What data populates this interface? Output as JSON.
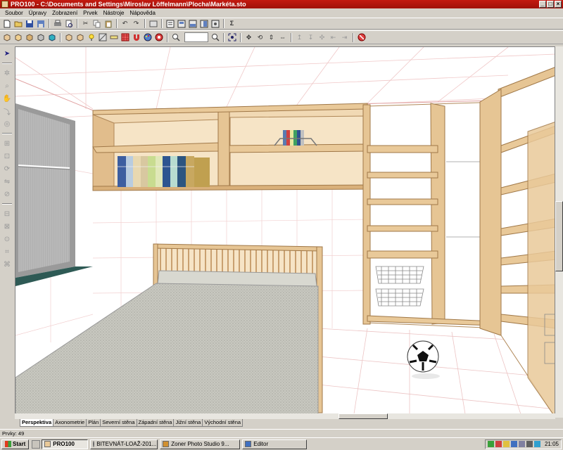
{
  "window": {
    "title": "PRO100 - C:\\Documents and Settings\\Miroslav Löffelmann\\Plocha\\Markéta.sto"
  },
  "menu": [
    "Soubor",
    "Úpravy",
    "Zobrazení",
    "Prvek",
    "Nástroje",
    "Nápověda"
  ],
  "toolbar1": [
    "new-icon",
    "open-icon",
    "save-icon",
    "save-as-icon",
    "print-icon",
    "print-preview-icon",
    "cut-icon",
    "copy-icon",
    "paste-icon",
    "undo-icon",
    "redo-icon",
    "export-icon",
    "catalog-icon",
    "report-icon",
    "list-icon",
    "materials-icon",
    "settings-icon",
    "sum-icon"
  ],
  "toolbar2": [
    "box-icon",
    "cube-icon",
    "cube2-icon",
    "cube3-icon",
    "cube4-icon",
    "cube5-icon",
    "cube6-icon",
    "light-icon",
    "texture-icon",
    "measure-icon",
    "grid-icon",
    "magnet-icon",
    "palette-icon",
    "render-icon",
    "zoom-out-icon",
    "zoom-in-icon",
    "select-all-icon",
    "move-icon",
    "rotate-icon",
    "align-icon",
    "stop-icon"
  ],
  "view_tabs": [
    "Perspektiva",
    "Axonometrie",
    "Plán",
    "Severní stěna",
    "Západní stěna",
    "Jižní stěna",
    "Východní stěna"
  ],
  "active_tab": "Perspektiva",
  "status": {
    "text": "Prvky: 49"
  },
  "taskbar": {
    "start_label": "Start",
    "pinned_app": "PRO100",
    "tasks": [
      "BITEVNÁT-LOAŽ-201...",
      "Zoner Photo Studio 9...",
      "Editor"
    ],
    "clock": "21:05"
  },
  "colors": {
    "title_bar": "#b8170e",
    "wood": "#e9c999",
    "wood_dark": "#c9a070",
    "floor_grid": "#e6b8b8"
  }
}
